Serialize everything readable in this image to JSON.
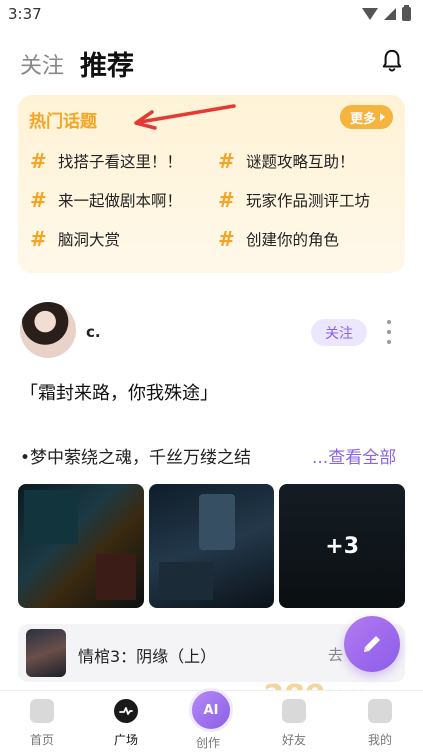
{
  "status_bar": {
    "time": "3:37",
    "icons": [
      "wifi-icon",
      "signal-icon",
      "battery-icon"
    ]
  },
  "header": {
    "tabs": [
      {
        "label": "关注",
        "active": false
      },
      {
        "label": "推荐",
        "active": true
      }
    ],
    "notification_icon": "bell-icon"
  },
  "hot_topics": {
    "title": "热门话题",
    "more_label": "更多",
    "items": [
      "找搭子看这里！！",
      "谜题攻略互助！",
      "来一起做剧本啊！",
      "玩家作品测评工坊",
      "脑洞大赏",
      "创建你的角色"
    ]
  },
  "post": {
    "username": "c.",
    "follow_label": "关注",
    "title": "「霜封来路，你我殊途」",
    "body": "•梦中萦绕之魂，千丝万缕之结",
    "view_all_label": "...查看全部",
    "extra_images_label": "+3"
  },
  "linked_work": {
    "title": "情棺3：阴缘（上）",
    "go_label": "去"
  },
  "bottom_nav": {
    "items": [
      {
        "label": "首页",
        "icon": "home-icon"
      },
      {
        "label": "广场",
        "icon": "pulse-icon",
        "active": true
      },
      {
        "label": "创作",
        "icon": "ai-icon",
        "badge": "AI"
      },
      {
        "label": "好友",
        "icon": "friends-icon"
      },
      {
        "label": "我的",
        "icon": "profile-icon"
      }
    ]
  },
  "colors": {
    "accent_purple": "#8a63e6",
    "topic_orange": "#f5a523",
    "highlight": "#d6f34a"
  }
}
